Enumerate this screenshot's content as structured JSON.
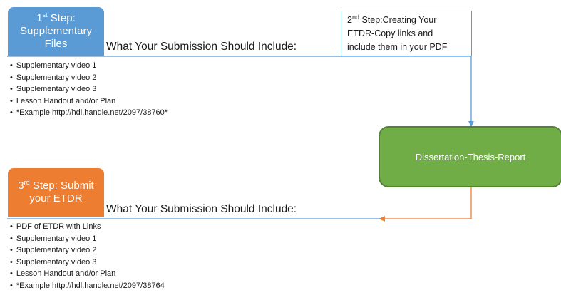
{
  "step1": {
    "sup": "st",
    "line1_rest": " Step:",
    "lines": [
      "Supplementary",
      "Files"
    ],
    "num": "1"
  },
  "step2": {
    "num": "2",
    "sup": "nd",
    "line1_rest": " Step:Creating Your",
    "lines": [
      "ETDR-Copy links and",
      "include them in your PDF"
    ]
  },
  "step3": {
    "num": "3",
    "sup": "rd",
    "line1_rest": " Step: Submit",
    "lines": [
      "your ETDR"
    ]
  },
  "center_box": {
    "label": "Dissertation-Thesis-Report"
  },
  "section1": {
    "heading": "What Your Submission Should Include:",
    "items": [
      "Supplementary  video 1",
      "Supplementary video 2",
      "Supplementary video 3",
      "Lesson Handout and/or Plan",
      "*Example http://hdl.handle.net/2097/38760*"
    ]
  },
  "section2": {
    "heading": "What Your Submission Should Include:",
    "items": [
      "PDF of ETDR with Links",
      "Supplementary  video 1",
      "Supplementary video 2",
      "Supplementary video 3",
      "Lesson Handout and/or Plan",
      "*Example http://hdl.handle.net/2097/38764"
    ]
  },
  "colors": {
    "blue": "#5b9bd5",
    "orange": "#ed7d31",
    "green": "#70ad47"
  }
}
